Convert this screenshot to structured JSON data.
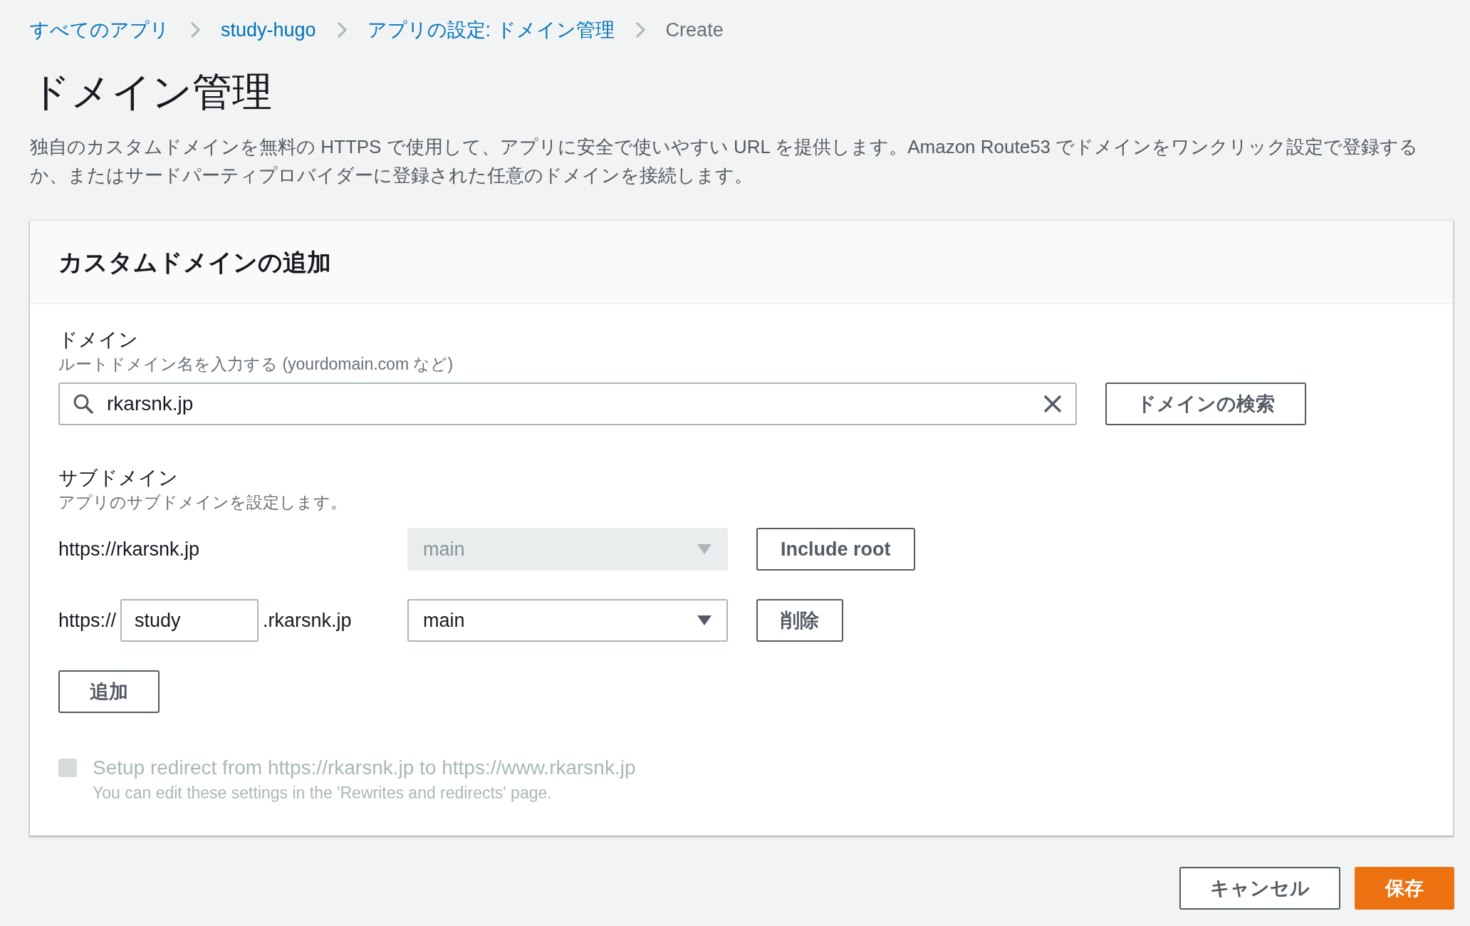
{
  "breadcrumbs": [
    {
      "label": "すべてのアプリ",
      "current": false
    },
    {
      "label": "study-hugo",
      "current": false
    },
    {
      "label": "アプリの設定: ドメイン管理",
      "current": false
    },
    {
      "label": "Create",
      "current": true
    }
  ],
  "title": "ドメイン管理",
  "description": "独自のカスタムドメインを無料の HTTPS で使用して、アプリに安全で使いやすい URL を提供します。Amazon Route53 でドメインをワンクリック設定で登録するか、またはサードパーティプロバイダーに登録された任意のドメインを接続します。",
  "panel": {
    "title": "カスタムドメインの追加",
    "domain": {
      "label": "ドメイン",
      "hint": "ルートドメイン名を入力する (yourdomain.com など)",
      "value": "rkarsnk.jp",
      "search_button": "ドメインの検索"
    },
    "subdomain": {
      "label": "サブドメイン",
      "hint": "アプリのサブドメインを設定します。",
      "rows": [
        {
          "kind": "root",
          "prefix": "https://rkarsnk.jp",
          "branch": "main",
          "disabled": true,
          "button": "Include root"
        },
        {
          "kind": "sub",
          "prefix": "https://",
          "value": "study",
          "suffix": ".rkarsnk.jp",
          "branch": "main",
          "disabled": false,
          "button": "削除"
        }
      ],
      "add_button": "追加"
    },
    "redirect": {
      "label": "Setup redirect from https://rkarsnk.jp to https://www.rkarsnk.jp",
      "hint": "You can edit these settings in the 'Rewrites and redirects' page.",
      "checked": false,
      "disabled": true
    }
  },
  "footer": {
    "cancel": "キャンセル",
    "save": "保存"
  }
}
